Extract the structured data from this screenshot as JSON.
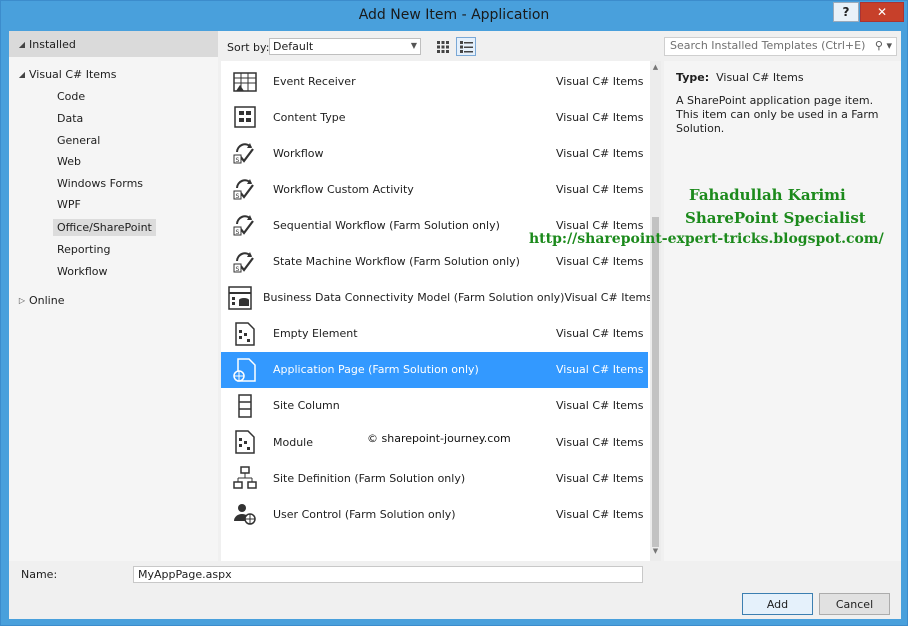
{
  "window": {
    "title": "Add New Item - Application",
    "help": "?",
    "close": "✕"
  },
  "tree": {
    "installed": "Installed",
    "group": "Visual C# Items",
    "children": [
      "Code",
      "Data",
      "General",
      "Web",
      "Windows Forms",
      "WPF",
      "Office/SharePoint",
      "Reporting",
      "Workflow"
    ],
    "selected": "Office/SharePoint",
    "online": "Online"
  },
  "toolbar": {
    "sort_label": "Sort by:",
    "sort_value": "Default"
  },
  "search": {
    "placeholder": "Search Installed Templates (Ctrl+E)"
  },
  "items": [
    {
      "name": "Event Receiver",
      "category": "Visual C# Items",
      "icon": "event-receiver-icon"
    },
    {
      "name": "Content Type",
      "category": "Visual C# Items",
      "icon": "content-type-icon"
    },
    {
      "name": "Workflow",
      "category": "Visual C# Items",
      "icon": "workflow-icon"
    },
    {
      "name": "Workflow Custom Activity",
      "category": "Visual C# Items",
      "icon": "workflow-activity-icon"
    },
    {
      "name": "Sequential Workflow (Farm Solution only)",
      "category": "Visual C# Items",
      "icon": "sequential-workflow-icon"
    },
    {
      "name": "State Machine Workflow (Farm Solution only)",
      "category": "Visual C# Items",
      "icon": "state-machine-workflow-icon"
    },
    {
      "name": "Business Data Connectivity Model (Farm Solution only)",
      "category": "Visual C# Items",
      "icon": "bdc-model-icon"
    },
    {
      "name": "Empty Element",
      "category": "Visual C# Items",
      "icon": "empty-element-icon"
    },
    {
      "name": "Application Page (Farm Solution only)",
      "category": "Visual C# Items",
      "icon": "application-page-icon"
    },
    {
      "name": "Site Column",
      "category": "Visual C# Items",
      "icon": "site-column-icon"
    },
    {
      "name": "Module",
      "category": "Visual C# Items",
      "icon": "module-icon"
    },
    {
      "name": "Site Definition (Farm Solution only)",
      "category": "Visual C# Items",
      "icon": "site-definition-icon"
    },
    {
      "name": "User Control (Farm Solution only)",
      "category": "Visual C# Items",
      "icon": "user-control-icon"
    }
  ],
  "selected_item": "Application Page (Farm Solution only)",
  "details": {
    "type_label": "Type:",
    "type_value": "Visual C# Items",
    "description": "A SharePoint application page item. This item can only be used in a Farm Solution."
  },
  "overlay": {
    "line1": "Fahadullah Karimi",
    "line2": "SharePoint Specialist",
    "line3": "http://sharepoint-expert-tricks.blogspot.com/",
    "watermark": "© sharepoint-journey.com",
    "color": "#1c8a1c"
  },
  "name_field": {
    "label": "Name:",
    "value": "MyAppPage.aspx"
  },
  "buttons": {
    "add": "Add",
    "cancel": "Cancel"
  },
  "colors": {
    "accent": "#3399ff",
    "titlebar": "#49a0dc",
    "close": "#c7402a"
  }
}
